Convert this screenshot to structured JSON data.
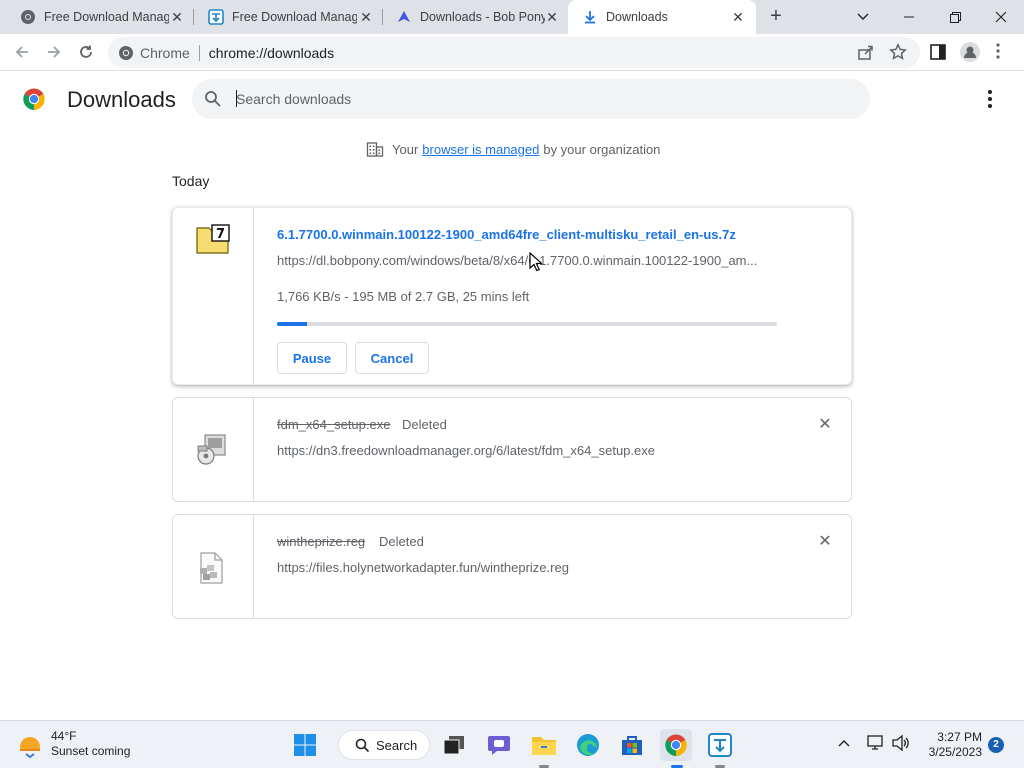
{
  "tabs": [
    {
      "title": "Free Download Manag",
      "icon": "chrome-icon",
      "active": false
    },
    {
      "title": "Free Download Manag",
      "icon": "fdm-icon",
      "active": false
    },
    {
      "title": "Downloads - Bob Pony",
      "icon": "bird-icon",
      "active": false
    },
    {
      "title": "Downloads",
      "icon": "download-icon",
      "active": true
    }
  ],
  "toolbar": {
    "site_chip": "Chrome",
    "url": "chrome://downloads"
  },
  "header": {
    "title": "Downloads",
    "search_placeholder": "Search downloads"
  },
  "managed": {
    "prefix": "Your",
    "link": "browser is managed",
    "suffix": "by your organization"
  },
  "section_label": "Today",
  "downloads": [
    {
      "filename": "6.1.7700.0.winmain.100122-1900_amd64fre_client-multisku_retail_en-us.7z",
      "url": "https://dl.bobpony.com/windows/beta/8/x64/6.1.7700.0.winmain.100122-1900_am...",
      "status": "1,766 KB/s - 195 MB of 2.7 GB, 25 mins left",
      "progress": 0.06,
      "pause_label": "Pause",
      "cancel_label": "Cancel"
    },
    {
      "filename": "fdm_x64_setup.exe",
      "tag": "Deleted",
      "url": "https://dn3.freedownloadmanager.org/6/latest/fdm_x64_setup.exe"
    },
    {
      "filename": "wintheprize.reg",
      "tag": "Deleted",
      "url": "https://files.holynetworkadapter.fun/wintheprize.reg"
    }
  ],
  "taskbar": {
    "weather_temp": "44°F",
    "weather_desc": "Sunset coming",
    "search_label": "Search",
    "time": "3:27 PM",
    "date": "3/25/2023",
    "notification_count": "2"
  },
  "colors": {
    "accent": "#1a73e8",
    "tabstrip": "#dee1e6",
    "taskbar": "#eef2f7"
  }
}
